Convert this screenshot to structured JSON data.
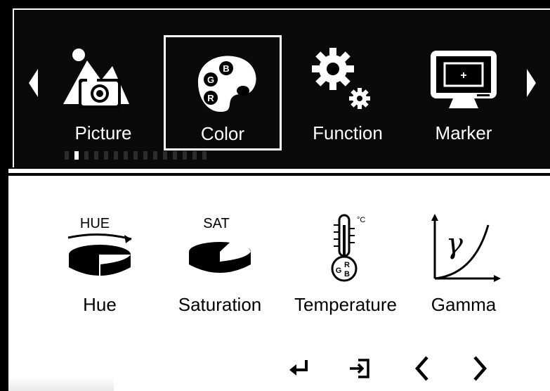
{
  "top_nav": {
    "categories": [
      {
        "label": "Picture",
        "icon": "picture-icon"
      },
      {
        "label": "Color",
        "icon": "color-palette-icon",
        "selected": true
      },
      {
        "label": "Function",
        "icon": "gears-icon"
      },
      {
        "label": "Marker",
        "icon": "monitor-marker-icon"
      }
    ],
    "page_indicator": {
      "total": 15,
      "active_index": 1
    }
  },
  "color_submenu": {
    "items": [
      {
        "label": "Hue",
        "icon": "hue-icon",
        "icon_text": "HUE"
      },
      {
        "label": "Saturation",
        "icon": "saturation-icon",
        "icon_text": "SAT"
      },
      {
        "label": "Temperature",
        "icon": "thermometer-icon",
        "icon_text": "°C"
      },
      {
        "label": "Gamma",
        "icon": "gamma-curve-icon",
        "icon_text": "γ"
      }
    ]
  },
  "controls": [
    {
      "icon": "enter-icon"
    },
    {
      "icon": "exit-icon"
    },
    {
      "icon": "chevron-left-icon"
    },
    {
      "icon": "chevron-right-icon"
    }
  ],
  "colors": {
    "panel_bg": "#000000",
    "text_on_dark": "#ffffff",
    "text_on_light": "#000000",
    "selection_border": "#ffffff"
  }
}
